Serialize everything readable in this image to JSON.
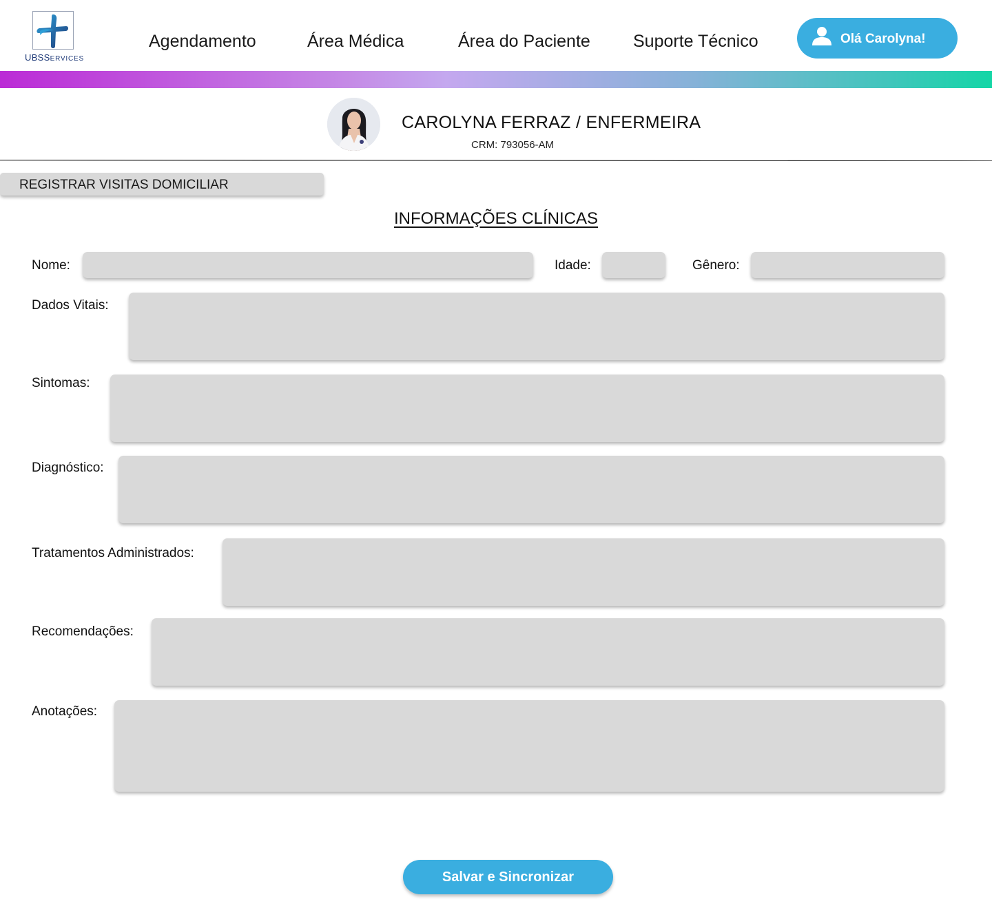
{
  "brand": {
    "logo_text_main": "UBS",
    "logo_text_small": "ERVICES",
    "logo_text_s": "S",
    "colors": {
      "primary": "#3aaee0",
      "logo_dark": "#1f3a78",
      "logo_light": "#2ea3dc"
    }
  },
  "nav": {
    "items": [
      {
        "label": "Agendamento"
      },
      {
        "label": "Área Médica"
      },
      {
        "label": "Área do Paciente"
      },
      {
        "label": "Suporte Técnico"
      }
    ],
    "user_button": {
      "label": "Olá Carolyna!",
      "icon": "user-icon"
    }
  },
  "profile": {
    "name": "CAROLYNA FERRAZ / ENFERMEIRA",
    "crm": "CRM: 793056-AM"
  },
  "section_tab": {
    "label": "REGISTRAR VISITAS DOMICILIAR"
  },
  "form": {
    "title": "INFORMAÇÕES CLÍNICAS",
    "fields": {
      "nome": {
        "label": "Nome:",
        "value": ""
      },
      "idade": {
        "label": "Idade:",
        "value": ""
      },
      "genero": {
        "label": "Gênero:",
        "value": ""
      },
      "dados_vitais": {
        "label": "Dados Vitais:",
        "value": ""
      },
      "sintomas": {
        "label": "Sintomas:",
        "value": ""
      },
      "diagnostico": {
        "label": "Diagnóstico:",
        "value": ""
      },
      "tratamentos": {
        "label": "Tratamentos Administrados:",
        "value": ""
      },
      "recomendacoes": {
        "label": "Recomendações:",
        "value": ""
      },
      "anotacoes": {
        "label": "Anotações:",
        "value": ""
      }
    },
    "submit_label": "Salvar e Sincronizar"
  }
}
